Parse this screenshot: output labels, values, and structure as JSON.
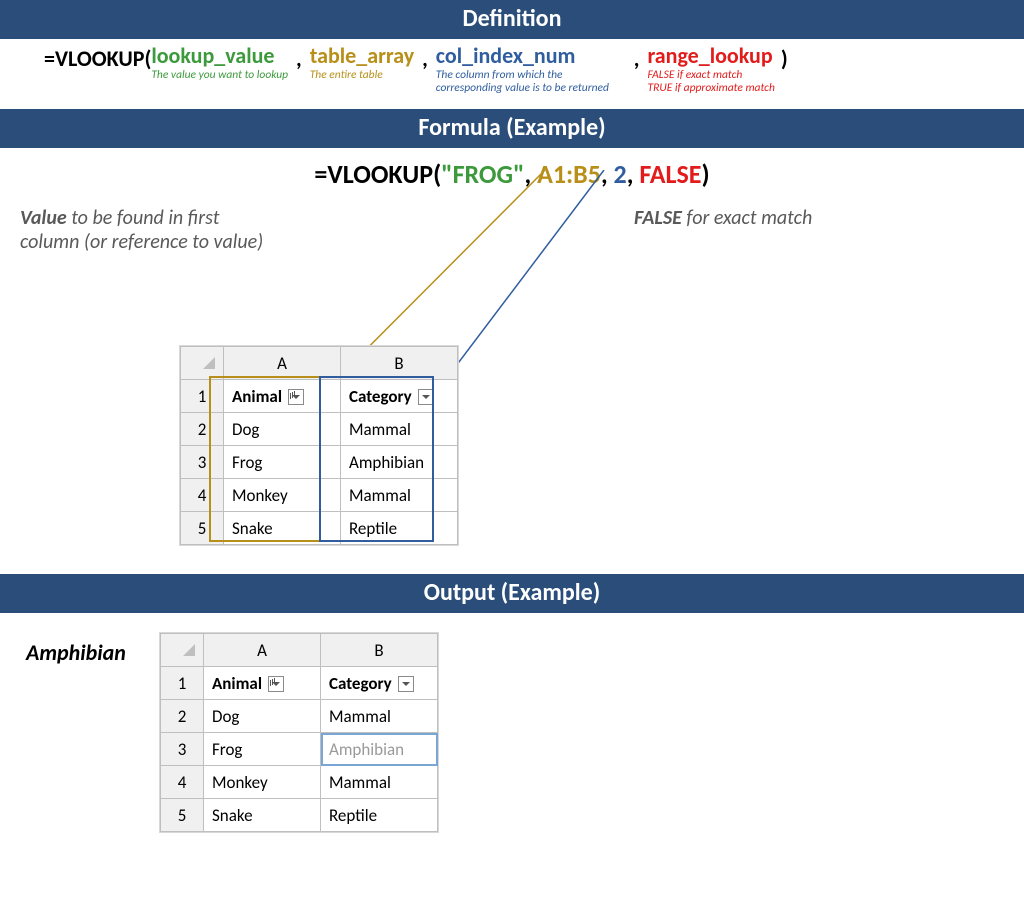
{
  "sections": {
    "definition": "Definition",
    "formula": "Formula (Example)",
    "output": "Output (Example)"
  },
  "definition": {
    "fn_open": "=VLOOKUP(",
    "close_paren": ")",
    "comma": ",",
    "args": {
      "lookup_value": {
        "name": "lookup_value",
        "desc": "The value you want to lookup"
      },
      "table_array": {
        "name": "table_array",
        "desc": "The entire table"
      },
      "col_index_num": {
        "name": "col_index_num",
        "desc": "The column from which the corresponding value is to be returned"
      },
      "range_lookup": {
        "name": "range_lookup",
        "desc": "FALSE if exact match\nTRUE if approximate match"
      }
    }
  },
  "formula_example": {
    "fn_open": "=VLOOKUP(",
    "lookup_value": "\"FROG\"",
    "table_array": "A1:B5",
    "col_index_num": "2",
    "range_lookup": "FALSE",
    "comma": ", ",
    "close_paren": ")"
  },
  "annotations": {
    "value_to_be_found": "Value to be found in first column (or reference to value)",
    "false_exact": "FALSE for exact match"
  },
  "output_label": "Amphibian",
  "table": {
    "col_headers": [
      "A",
      "B"
    ],
    "row_headers": [
      "1",
      "2",
      "3",
      "4",
      "5"
    ],
    "header_row": {
      "a": "Animal",
      "b": "Category"
    },
    "rows": [
      {
        "a": "Dog",
        "b": "Mammal"
      },
      {
        "a": "Frog",
        "b": "Amphibian"
      },
      {
        "a": "Monkey",
        "b": "Mammal"
      },
      {
        "a": "Snake",
        "b": "Reptile"
      }
    ]
  },
  "table_output_selected": {
    "row": 3,
    "col": "b"
  }
}
